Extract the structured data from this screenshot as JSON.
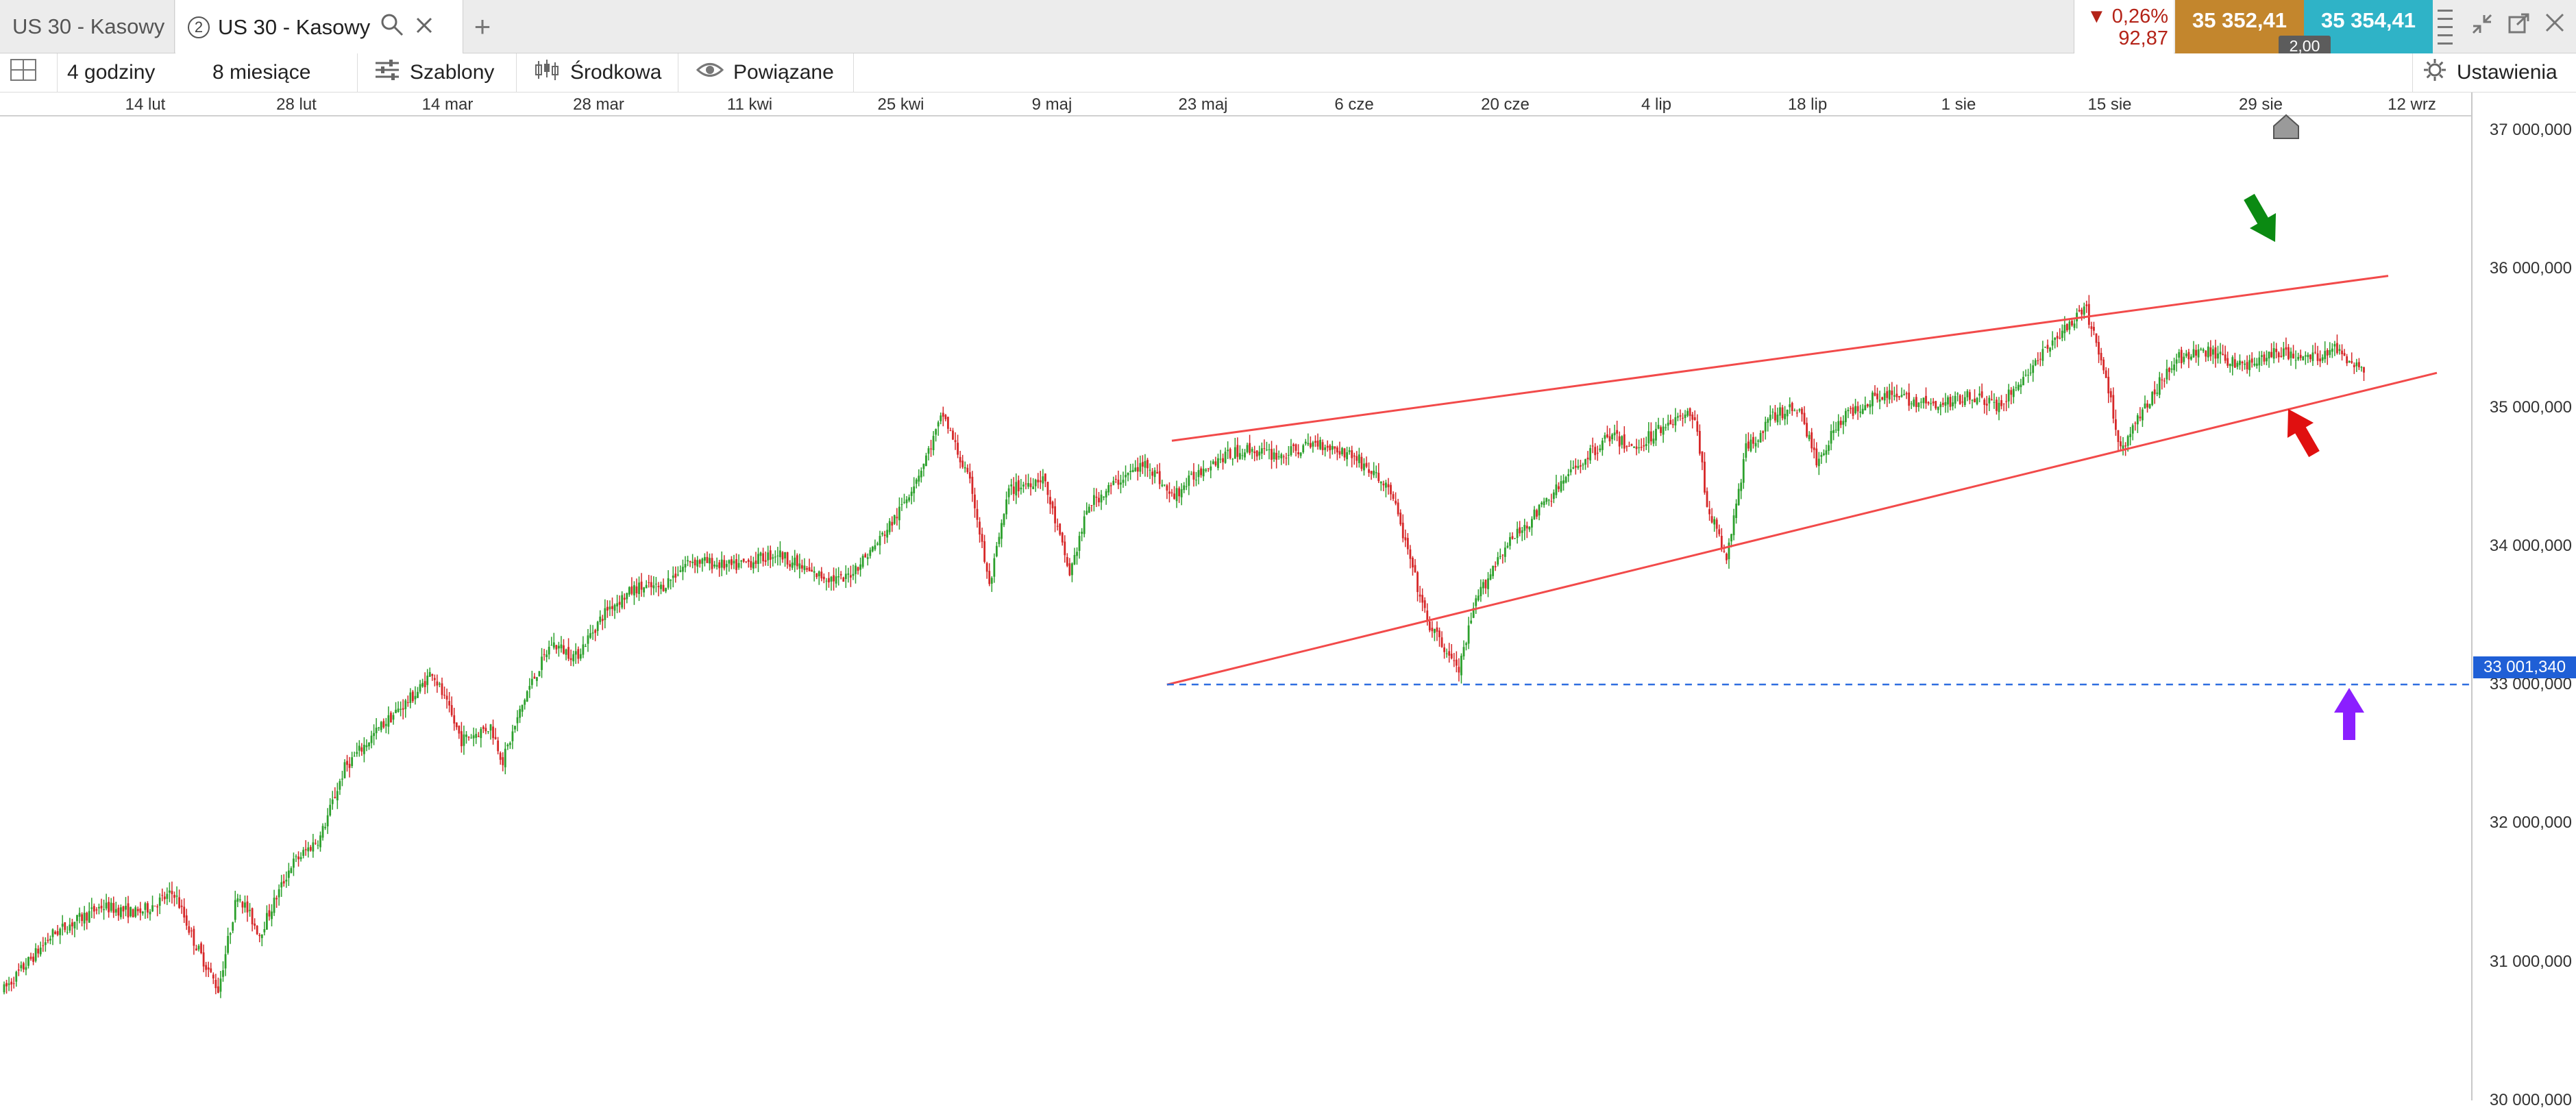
{
  "tabs": [
    {
      "label": "US 30 - Kasowy"
    },
    {
      "number": "2",
      "label": "US 30 - Kasowy"
    }
  ],
  "price": {
    "change_pct": "0,26%",
    "change_abs": "92,87",
    "direction": "down",
    "bid": "35 352,41",
    "ask": "35 354,41",
    "spread": "2,00",
    "colors": {
      "bid": "#c3862d",
      "ask": "#2fb3c7",
      "down": "#b42318"
    }
  },
  "toolbar": {
    "interval": "4 godziny",
    "range": "8 miesiące",
    "templates": "Szablony",
    "average": "Środkowa",
    "linked": "Powiązane",
    "settings": "Ustawienia"
  },
  "chart_data": {
    "type": "candlestick",
    "x_ticks": [
      "14 lut",
      "28 lut",
      "14 mar",
      "28 mar",
      "11 kwi",
      "25 kwi",
      "9 maj",
      "23 maj",
      "6 cze",
      "20 cze",
      "4 lip",
      "18 lip",
      "1 sie",
      "15 sie",
      "29 sie",
      "12 wrz"
    ],
    "y_ticks": [
      "30 000,000",
      "31 000,000",
      "32 000,000",
      "33 000,000",
      "34 000,000",
      "35 000,000",
      "36 000,000",
      "37 000,000"
    ],
    "ylim": [
      30000,
      37100
    ],
    "price_path": [
      [
        0,
        30800
      ],
      [
        20,
        31200
      ],
      [
        40,
        31400
      ],
      [
        55,
        31350
      ],
      [
        70,
        31500
      ],
      [
        78,
        31150
      ],
      [
        88,
        30800
      ],
      [
        96,
        31500
      ],
      [
        105,
        31200
      ],
      [
        118,
        31700
      ],
      [
        130,
        31900
      ],
      [
        140,
        32400
      ],
      [
        155,
        32700
      ],
      [
        170,
        32950
      ],
      [
        176,
        33100
      ],
      [
        188,
        32600
      ],
      [
        200,
        32700
      ],
      [
        205,
        32450
      ],
      [
        215,
        32950
      ],
      [
        225,
        33300
      ],
      [
        235,
        33200
      ],
      [
        248,
        33550
      ],
      [
        260,
        33700
      ],
      [
        270,
        33700
      ],
      [
        282,
        33900
      ],
      [
        300,
        33850
      ],
      [
        318,
        33950
      ],
      [
        332,
        33800
      ],
      [
        345,
        33750
      ],
      [
        358,
        34000
      ],
      [
        368,
        34250
      ],
      [
        378,
        34600
      ],
      [
        386,
        34950
      ],
      [
        398,
        34400
      ],
      [
        405,
        33700
      ],
      [
        413,
        34400
      ],
      [
        427,
        34500
      ],
      [
        438,
        33800
      ],
      [
        446,
        34300
      ],
      [
        460,
        34500
      ],
      [
        470,
        34600
      ],
      [
        480,
        34350
      ],
      [
        495,
        34600
      ],
      [
        510,
        34700
      ],
      [
        525,
        34650
      ],
      [
        540,
        34750
      ],
      [
        555,
        34650
      ],
      [
        570,
        34400
      ],
      [
        585,
        33450
      ],
      [
        598,
        33100
      ],
      [
        605,
        33600
      ],
      [
        615,
        33950
      ],
      [
        628,
        34200
      ],
      [
        645,
        34550
      ],
      [
        660,
        34800
      ],
      [
        670,
        34700
      ],
      [
        684,
        34900
      ],
      [
        695,
        34950
      ],
      [
        700,
        34300
      ],
      [
        708,
        33900
      ],
      [
        716,
        34700
      ],
      [
        728,
        34950
      ],
      [
        738,
        35000
      ],
      [
        745,
        34600
      ],
      [
        754,
        34900
      ],
      [
        770,
        35100
      ],
      [
        785,
        35050
      ],
      [
        795,
        35000
      ],
      [
        808,
        35100
      ],
      [
        820,
        35000
      ],
      [
        834,
        35300
      ],
      [
        846,
        35550
      ],
      [
        856,
        35700
      ],
      [
        864,
        35200
      ],
      [
        870,
        34700
      ],
      [
        880,
        35000
      ],
      [
        892,
        35350
      ],
      [
        906,
        35400
      ],
      [
        920,
        35300
      ],
      [
        935,
        35400
      ],
      [
        948,
        35350
      ],
      [
        958,
        35420
      ],
      [
        970,
        35280
      ]
    ],
    "upper_trendline": {
      "from": [
        480,
        34760
      ],
      "to": [
        980,
        35950
      ]
    },
    "lower_trendline": {
      "from": [
        478,
        33000
      ],
      "to": [
        1000,
        35250
      ]
    },
    "support_level": 33001.34,
    "support_label": "33 001,340",
    "annotations": [
      "down-arrow-green",
      "up-arrow-red",
      "up-arrow-purple"
    ],
    "colors": {
      "up": "#2ca02c",
      "down": "#d62728",
      "trendline": "#f24a4a",
      "support": "#2f6fe0"
    }
  }
}
